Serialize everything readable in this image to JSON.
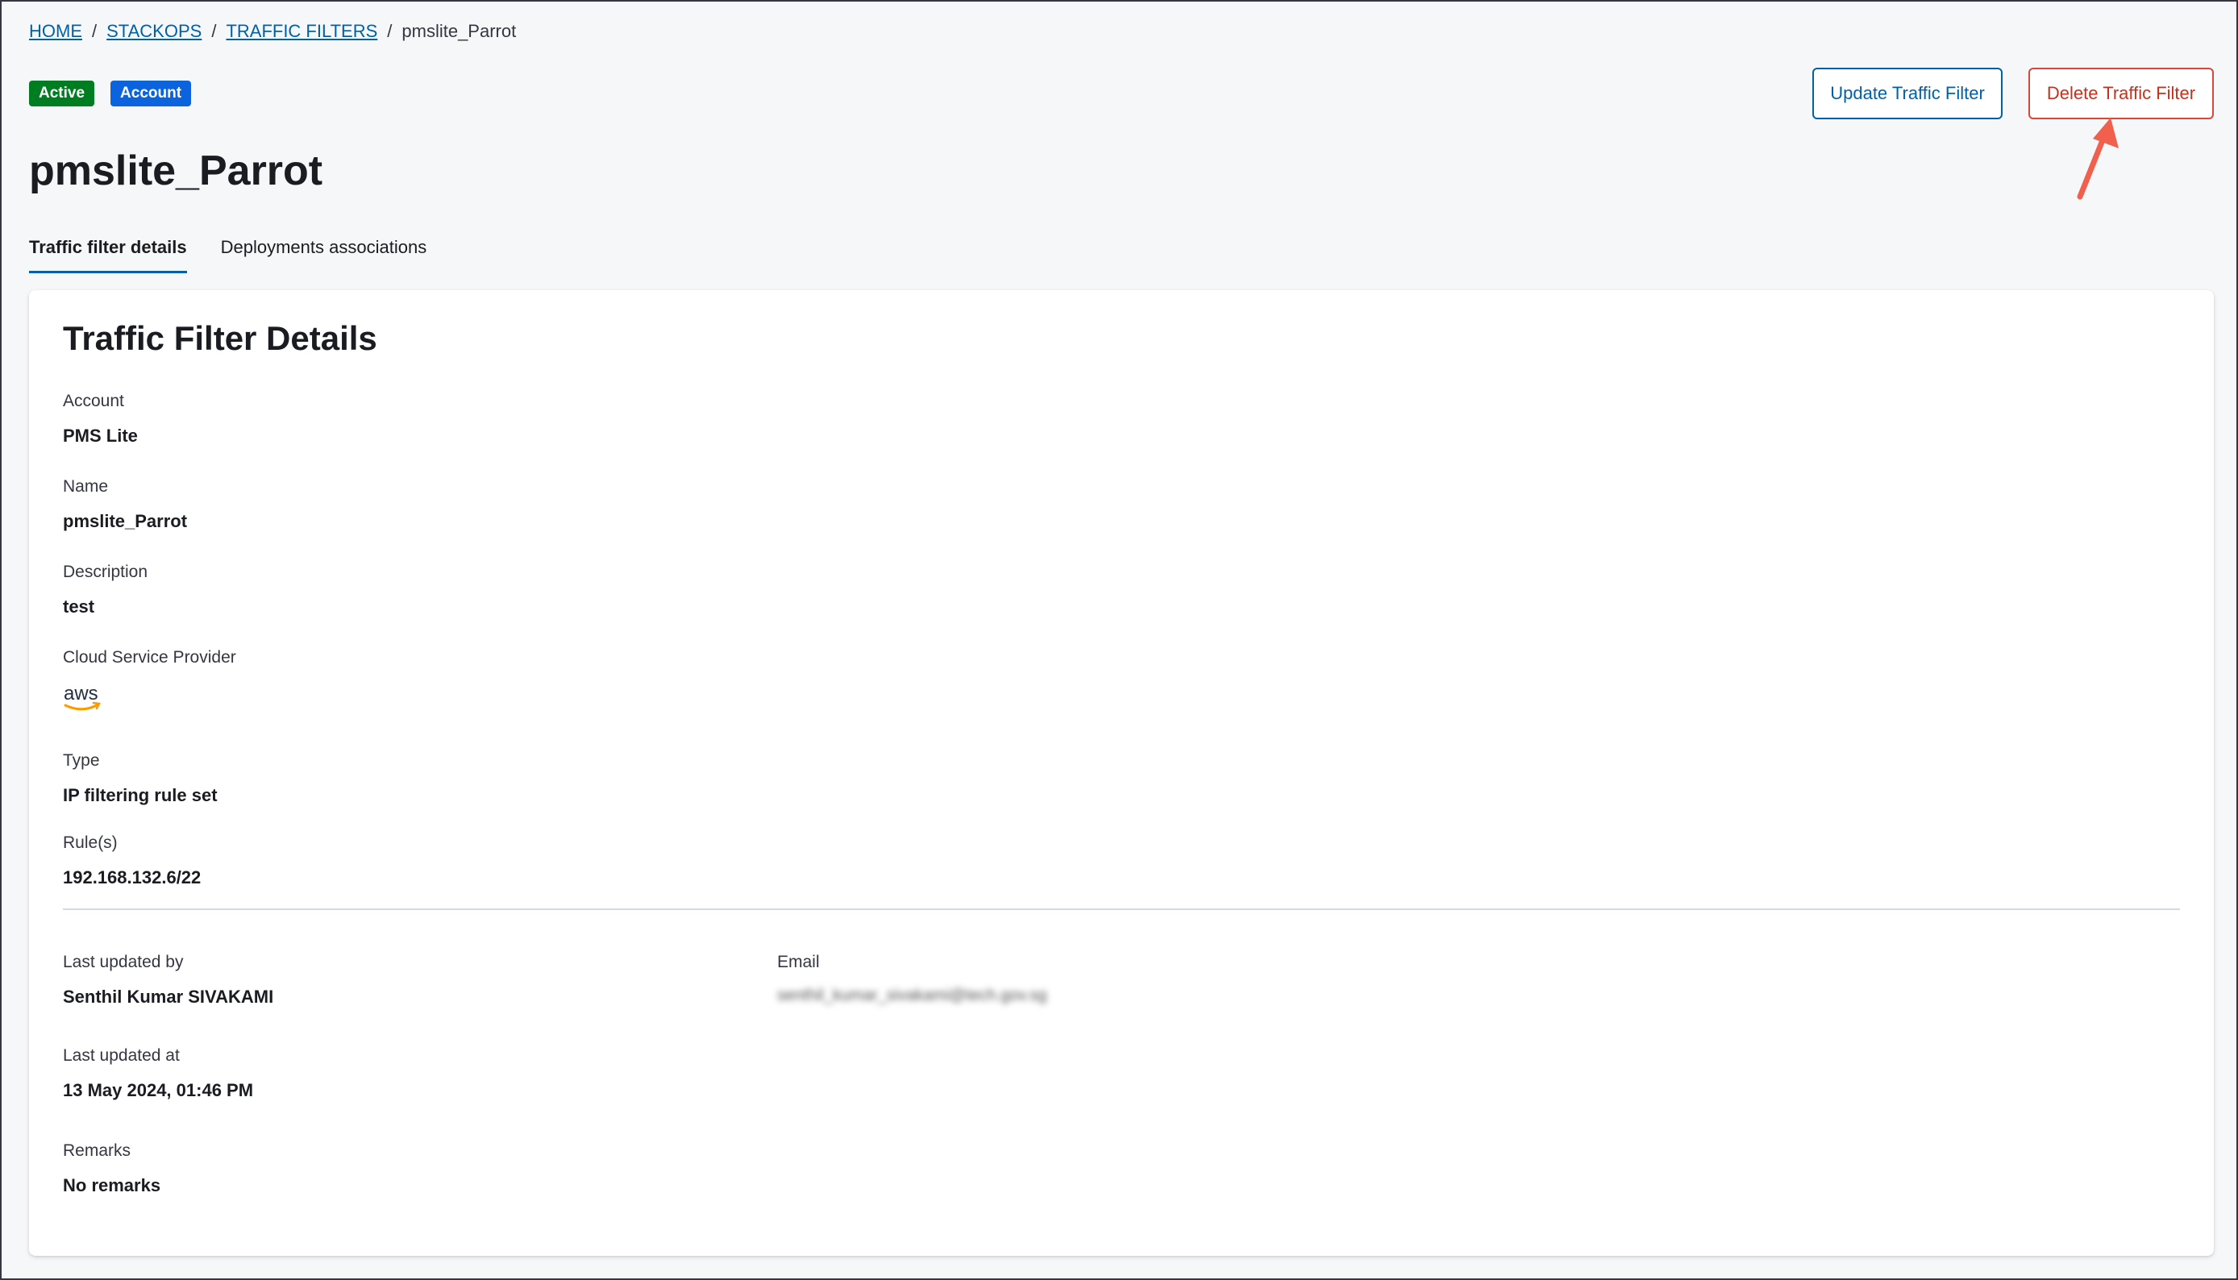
{
  "breadcrumb": {
    "items": [
      "HOME",
      "STACKOPS",
      "TRAFFIC FILTERS"
    ],
    "separator": "/",
    "current": "pmslite_Parrot"
  },
  "badges": {
    "status": "Active",
    "scope": "Account"
  },
  "actions": {
    "update_label": "Update Traffic Filter",
    "delete_label": "Delete Traffic Filter"
  },
  "page": {
    "title": "pmslite_Parrot"
  },
  "tabs": [
    {
      "label": "Traffic filter details",
      "selected": true
    },
    {
      "label": "Deployments associations",
      "selected": false
    }
  ],
  "details": {
    "title": "Traffic Filter Details",
    "account": {
      "label": "Account",
      "value": "PMS Lite"
    },
    "name": {
      "label": "Name",
      "value": "pmslite_Parrot"
    },
    "description": {
      "label": "Description",
      "value": "test"
    },
    "csp": {
      "label": "Cloud Service Provider",
      "logo_text": "aws",
      "logo_icon": "aws-logo-icon"
    },
    "type": {
      "label": "Type",
      "value": "IP filtering rule set"
    },
    "rules": {
      "label": "Rule(s)",
      "value": "192.168.132.6/22"
    },
    "last_updated_by": {
      "label": "Last updated by",
      "value": "Senthil Kumar SIVAKAMI"
    },
    "email": {
      "label": "Email",
      "value": "senthil_kumar_sivakami@tech.gov.sg"
    },
    "last_updated_at": {
      "label": "Last updated at",
      "value": "13 May 2024, 01:46 PM"
    },
    "remarks": {
      "label": "Remarks",
      "value": "No remarks"
    }
  },
  "colors": {
    "link": "#0061a6",
    "active_badge": "#017d21",
    "account_badge": "#0b64dd",
    "danger": "#c4311d",
    "annotation_arrow": "#f0604d",
    "aws_orange": "#ff9900"
  }
}
